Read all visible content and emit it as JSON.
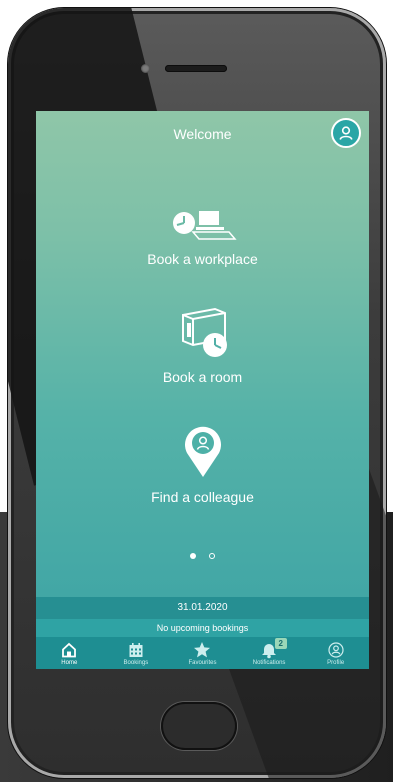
{
  "header": {
    "title": "Welcome"
  },
  "actions": [
    {
      "label": "Book a workplace",
      "icon": "workplace-icon"
    },
    {
      "label": "Book a room",
      "icon": "room-clock-icon"
    },
    {
      "label": "Find a colleague",
      "icon": "location-person-icon"
    }
  ],
  "pager": {
    "total": 2,
    "active": 0
  },
  "status": {
    "date": "31.01.2020",
    "bookings": "No upcoming bookings"
  },
  "tabs": [
    {
      "label": "Home",
      "icon": "home-icon",
      "active": true
    },
    {
      "label": "Bookings",
      "icon": "calendar-icon",
      "active": false
    },
    {
      "label": "Favourites",
      "icon": "star-icon",
      "active": false
    },
    {
      "label": "Notifications",
      "icon": "bell-icon",
      "active": false,
      "badge": "2"
    },
    {
      "label": "Profile",
      "icon": "profile-icon",
      "active": false
    }
  ],
  "colors": {
    "screen_top": "#8fc6a8",
    "screen_bottom": "#3aa2a4",
    "bar_dark": "#268f92",
    "tabbar": "#1e8e92",
    "accent": "#2aa6a6"
  }
}
